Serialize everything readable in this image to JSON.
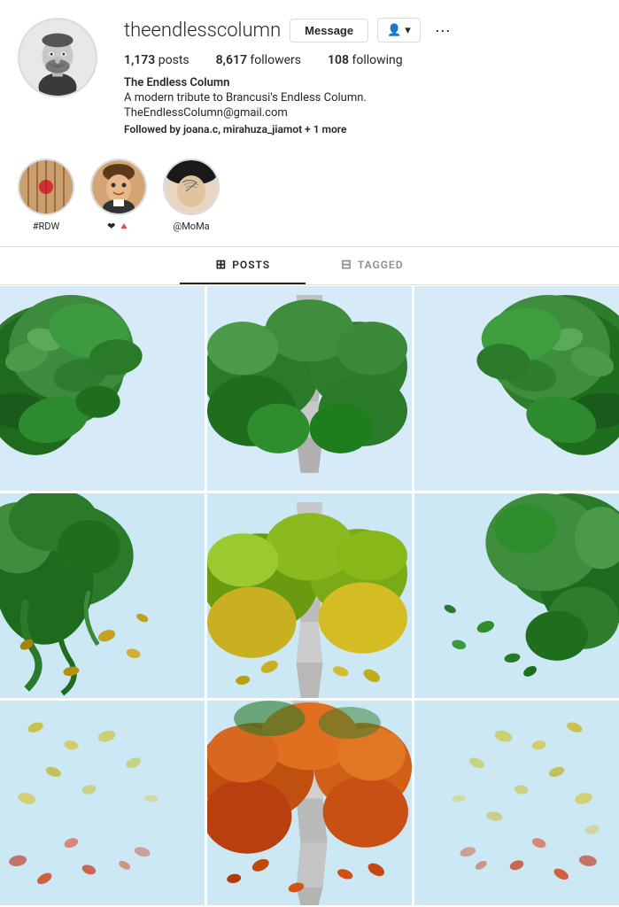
{
  "profile": {
    "username": "theendlesscolumn",
    "avatar_alt": "Black and white portrait of bearded man",
    "stats": {
      "posts_label": "posts",
      "posts_value": "1,173",
      "followers_label": "followers",
      "followers_value": "8,617",
      "following_label": "following",
      "following_value": "108"
    },
    "bio": {
      "name": "The Endless Column",
      "description": "A modern tribute to Brancusi's Endless Column.",
      "email": "TheEndlessColumn@gmail.com"
    },
    "followed_by_text": "Followed by",
    "followed_by_users": "joana.c, mirahuza_jiamot",
    "followed_by_more": "+ 1 more"
  },
  "buttons": {
    "message": "Message",
    "follow_arrow": "▾",
    "dots": "···"
  },
  "stories": [
    {
      "id": "rdw",
      "label": "#RDW",
      "type": "pattern"
    },
    {
      "id": "heart",
      "label": "❤ 🔺",
      "type": "face"
    },
    {
      "id": "moma",
      "label": "@MoMa",
      "type": "tattoo"
    }
  ],
  "tabs": [
    {
      "id": "posts",
      "label": "POSTS",
      "icon": "⊞",
      "active": true
    },
    {
      "id": "tagged",
      "label": "TAGGED",
      "icon": "⊟",
      "active": false
    }
  ],
  "grid": {
    "items": [
      {
        "id": 1,
        "desc": "green foliage shape left top - light blue bg"
      },
      {
        "id": 2,
        "desc": "endless column center with green foliage - light blue bg"
      },
      {
        "id": 3,
        "desc": "green foliage shape right - light blue bg"
      },
      {
        "id": 4,
        "desc": "green vines falling left - light blue bg"
      },
      {
        "id": 5,
        "desc": "column yellow-green foliage center - light blue bg"
      },
      {
        "id": 6,
        "desc": "green foliage right falling - light blue bg"
      },
      {
        "id": 7,
        "desc": "light foliage fading bottom left - light blue bg"
      },
      {
        "id": 8,
        "desc": "column orange-autumn foliage center - light blue bg"
      },
      {
        "id": 9,
        "desc": "light foliage fading bottom right - light blue bg"
      }
    ]
  },
  "colors": {
    "bg_light_blue": "#d6eaf8",
    "accent": "#262626",
    "border": "#dbdbdb"
  }
}
